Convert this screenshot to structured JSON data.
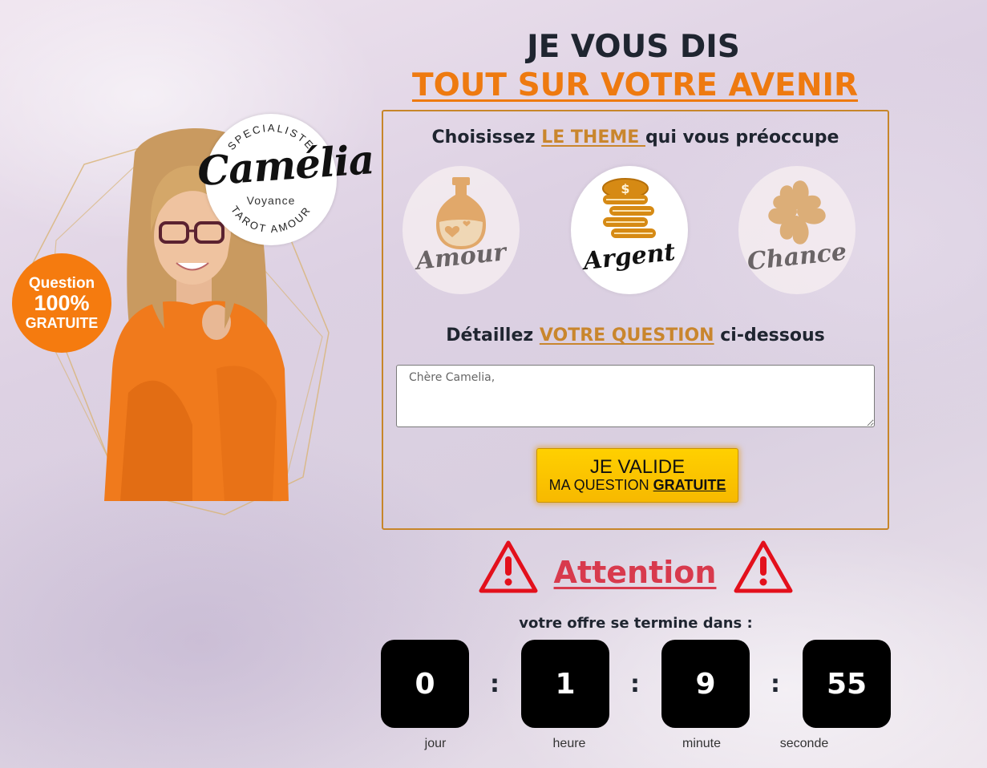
{
  "header": {
    "title_line1": "JE VOUS DIS",
    "title_line2": "TOUT SUR VOTRE AVENIR"
  },
  "logo": {
    "top_text": "SPECIALISTE",
    "name": "Camélia",
    "sub": "Voyance",
    "bottom_text": "TAROT AMOUR"
  },
  "badge": {
    "line1": "Question",
    "line2": "100%",
    "line3": "GRATUITE"
  },
  "form": {
    "theme_heading_pre": "Choisissez ",
    "theme_heading_accent": "LE THEME ",
    "theme_heading_post": "qui vous préoccupe",
    "themes": [
      {
        "label": "Amour",
        "icon": "potion-bottle-icon",
        "selected": false
      },
      {
        "label": "Argent",
        "icon": "coins-stack-icon",
        "selected": true
      },
      {
        "label": "Chance",
        "icon": "four-leaf-clover-icon",
        "selected": false
      }
    ],
    "question_heading_pre": "Détaillez ",
    "question_heading_accent": "VOTRE QUESTION",
    "question_heading_post": " ci-dessous",
    "question_placeholder": "Chère Camelia,",
    "submit_line1": "JE VALIDE",
    "submit_line2_pre": "MA QUESTION ",
    "submit_line2_bold": "GRATUITE"
  },
  "attention": {
    "title": "Attention",
    "icon": "warning-triangle-icon",
    "offer_text": "votre offre se termine dans :"
  },
  "countdown": {
    "days": "0",
    "hours": "1",
    "minutes": "9",
    "seconds": "55",
    "separator": ":",
    "days_label": "jour",
    "hours_label": "heure",
    "minutes_label": "minute",
    "seconds_label": "seconde"
  },
  "colors": {
    "accent_orange": "#ee7a10",
    "accent_gold": "#c9862d",
    "attention_red": "#d83a4d",
    "button_yellow": "#ffd000"
  }
}
